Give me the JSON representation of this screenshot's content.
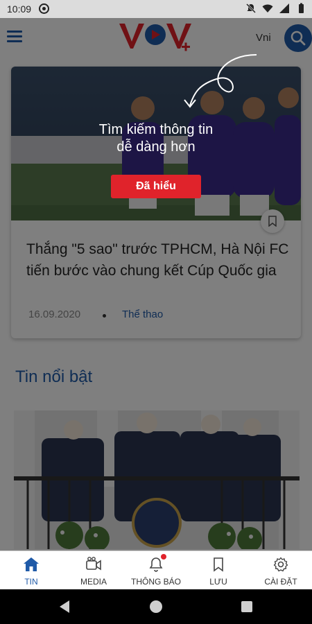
{
  "status_bar": {
    "time": "10:09"
  },
  "header": {
    "lang_label": "Vni",
    "logo_text": "VOV"
  },
  "onboarding": {
    "message_line1": "Tìm kiếm thông tin",
    "message_line2": "dễ dàng hơn",
    "button_label": "Đã hiểu"
  },
  "hero": {
    "title": "Thắng \"5 sao\" trước TPHCM, Hà Nội FC tiến bước vào chung kết Cúp Quốc gia",
    "date": "16.09.2020",
    "category": "Thể thao"
  },
  "section": {
    "title": "Tin nổi bật"
  },
  "bottom_nav": [
    {
      "label": "TIN",
      "icon": "home-icon",
      "active": true
    },
    {
      "label": "MEDIA",
      "icon": "video-camera-icon",
      "active": false
    },
    {
      "label": "THÔNG BÁO",
      "icon": "bell-icon",
      "active": false
    },
    {
      "label": "LƯU",
      "icon": "bookmark-icon",
      "active": false
    },
    {
      "label": "CÀI ĐẶT",
      "icon": "gear-icon",
      "active": false
    }
  ],
  "colors": {
    "brand_blue": "#1f5aa8",
    "brand_red": "#e0232b"
  }
}
